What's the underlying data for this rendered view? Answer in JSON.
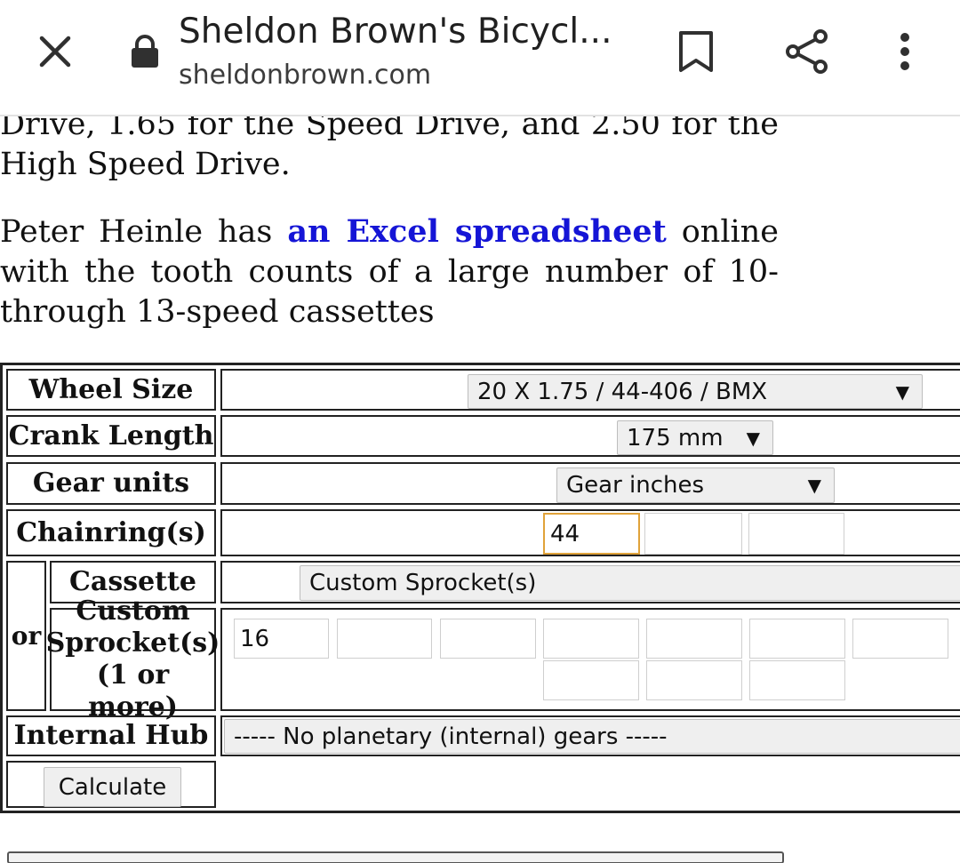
{
  "browser": {
    "title": "Sheldon Brown's Bicycl...",
    "url": "sheldonbrown.com",
    "icons": {
      "close": "close-icon",
      "lock": "lock-icon",
      "bookmark": "bookmark-icon",
      "share": "share-icon",
      "menu": "more-vert-icon"
    }
  },
  "article": {
    "p1": "Drive, 1.65 for the Speed Drive, and 2.50 for the High Speed Drive.",
    "p2_before": "Peter Heinle has ",
    "p2_link": "an Excel spreadsheet",
    "p2_after": " online with the tooth counts of a large number of 10- through 13-speed cassettes"
  },
  "calculator": {
    "wheel_size": {
      "label": "Wheel Size",
      "selected": "20 X 1.75 / 44-406 / BMX"
    },
    "crank_length": {
      "label": "Crank Length",
      "selected": "175 mm"
    },
    "gear_units": {
      "label": "Gear units",
      "selected": "Gear inches"
    },
    "chainrings": {
      "label": "Chainring(s)",
      "values": [
        "44",
        "",
        ""
      ]
    },
    "or_label": "or",
    "cassette": {
      "label": "Cassette",
      "selected": "Custom Sprocket(s)"
    },
    "custom_sprockets": {
      "label_line1": "Custom",
      "label_line2": "Sprocket(s)",
      "label_line3": "(1 or more)",
      "values": [
        "16",
        "",
        "",
        "",
        "",
        "",
        "",
        "",
        "",
        ""
      ]
    },
    "internal_hub": {
      "label": "Internal Hub",
      "selected": "----- No planetary (internal) gears -----"
    },
    "calculate_label": "Calculate"
  },
  "colors": {
    "link": "#1515d6",
    "focus_border": "#e0a23a",
    "button_bg": "#efefef"
  }
}
